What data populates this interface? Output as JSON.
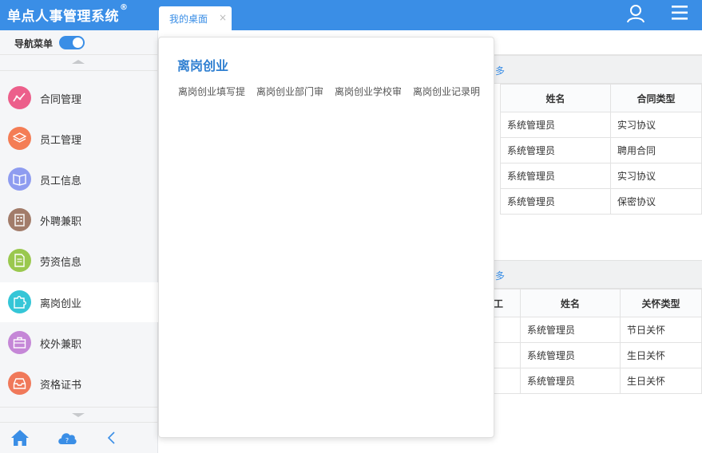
{
  "app": {
    "title": "单点人事管理系统",
    "title_mark": "®"
  },
  "tabs": [
    {
      "label": "我的桌面",
      "close": "×"
    }
  ],
  "header_icons": {
    "user": "user-icon",
    "menu": "hamburger-menu-icon"
  },
  "sidebar": {
    "nav_toggle_label": "导航菜单",
    "nav_toggle_on": true,
    "items": [
      {
        "label": "合同管理",
        "icon": "trend-line-icon",
        "color": "#ec5f8b"
      },
      {
        "label": "员工管理",
        "icon": "layers-icon",
        "color": "#f47d55"
      },
      {
        "label": "员工信息",
        "icon": "book-icon",
        "color": "#8e9cf0"
      },
      {
        "label": "外聘兼职",
        "icon": "building-icon",
        "color": "#a27c6a"
      },
      {
        "label": "劳资信息",
        "icon": "document-icon",
        "color": "#9ac84e"
      },
      {
        "label": "离岗创业",
        "icon": "puzzle-icon",
        "color": "#35c6d7",
        "active": true
      },
      {
        "label": "校外兼职",
        "icon": "briefcase-icon",
        "color": "#c587d7"
      },
      {
        "label": "资格证书",
        "icon": "inbox-icon",
        "color": "#f0795a"
      }
    ],
    "bottom_icons": [
      "home-icon",
      "cloud-help-icon",
      "collapse-left-icon"
    ]
  },
  "panels": [
    {
      "more": "多",
      "columns": [
        "姓名",
        "合同类型"
      ],
      "rows": [
        [
          "系统管理员",
          "实习协议"
        ],
        [
          "系统管理员",
          "聘用合同"
        ],
        [
          "系统管理员",
          "实习协议"
        ],
        [
          "系统管理员",
          "保密协议"
        ]
      ]
    },
    {
      "more": "多",
      "columns": [
        "工",
        "姓名",
        "关怀类型"
      ],
      "rows": [
        [
          "",
          "系统管理员",
          "节日关怀"
        ],
        [
          "",
          "系统管理员",
          "生日关怀"
        ],
        [
          "",
          "系统管理员",
          "生日关怀"
        ]
      ]
    }
  ],
  "popup": {
    "title": "离岗创业",
    "links": [
      "离岗创业填写提",
      "离岗创业部门审",
      "离岗创业学校审",
      "离岗创业记录明"
    ]
  },
  "colors": {
    "primary": "#3a8ee6",
    "popup_title": "#2f7fd1"
  }
}
